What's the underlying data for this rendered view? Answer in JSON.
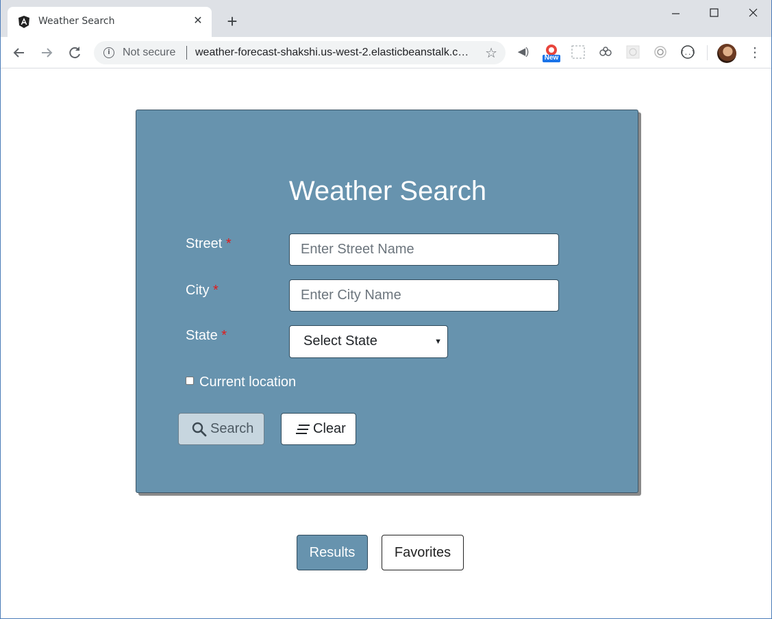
{
  "browser": {
    "tab_title": "Weather Search",
    "security_label": "Not secure",
    "url": "weather-forecast-shakshi.us-west-2.elasticbeanstalk.com",
    "extension_badge": "New"
  },
  "search_form": {
    "title": "Weather Search",
    "street": {
      "label": "Street",
      "required_mark": "*",
      "placeholder": "Enter Street Name",
      "value": ""
    },
    "city": {
      "label": "City",
      "required_mark": "*",
      "placeholder": "Enter City Name",
      "value": ""
    },
    "state": {
      "label": "State",
      "required_mark": "*",
      "selected": "Select State"
    },
    "current_location": {
      "label": "Current location",
      "checked": false
    },
    "search_button": "Search",
    "clear_button": "Clear"
  },
  "view_tabs": {
    "results": "Results",
    "favorites": "Favorites"
  },
  "colors": {
    "card_background": "#6793ae",
    "required_mark": "#e01b1b",
    "results_tab_active": "#6793ae"
  }
}
